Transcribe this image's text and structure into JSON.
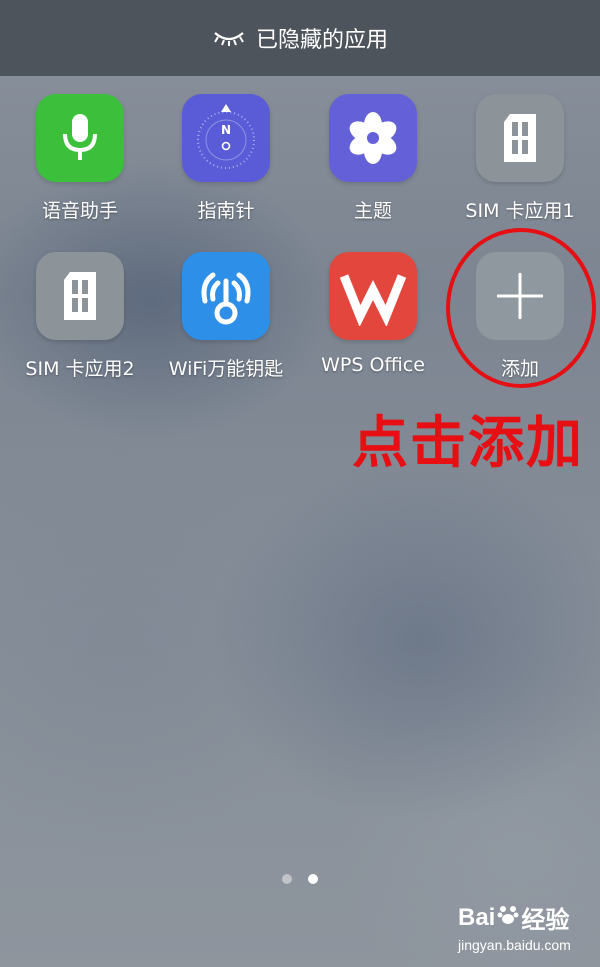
{
  "header": {
    "title": "已隐藏的应用",
    "icon": "closed-eye-icon"
  },
  "apps": [
    {
      "label": "语音助手",
      "icon": "microphone-icon",
      "color": "#3cc03c"
    },
    {
      "label": "指南针",
      "icon": "compass-icon",
      "color": "#5a5bd6"
    },
    {
      "label": "主题",
      "icon": "theme-flower-icon",
      "color": "#6460d8"
    },
    {
      "label": "SIM 卡应用1",
      "icon": "sim-card-icon",
      "color": "#8c949a"
    },
    {
      "label": "SIM 卡应用2",
      "icon": "sim-card-icon",
      "color": "#8c949a"
    },
    {
      "label": "WiFi万能钥匙",
      "icon": "wifi-key-icon",
      "color": "#2e8fe8"
    },
    {
      "label": "WPS Office",
      "icon": "wps-office-icon",
      "color": "#e2463c"
    },
    {
      "label": "添加",
      "icon": "plus-icon",
      "color": "#8f979f"
    }
  ],
  "annotation": {
    "text": "点击添加",
    "color": "#e60f14"
  },
  "pagination": {
    "total": 2,
    "active": 2
  },
  "watermark": {
    "brand": "Bai",
    "brand2": "经验",
    "url": "jingyan.baidu.com"
  }
}
